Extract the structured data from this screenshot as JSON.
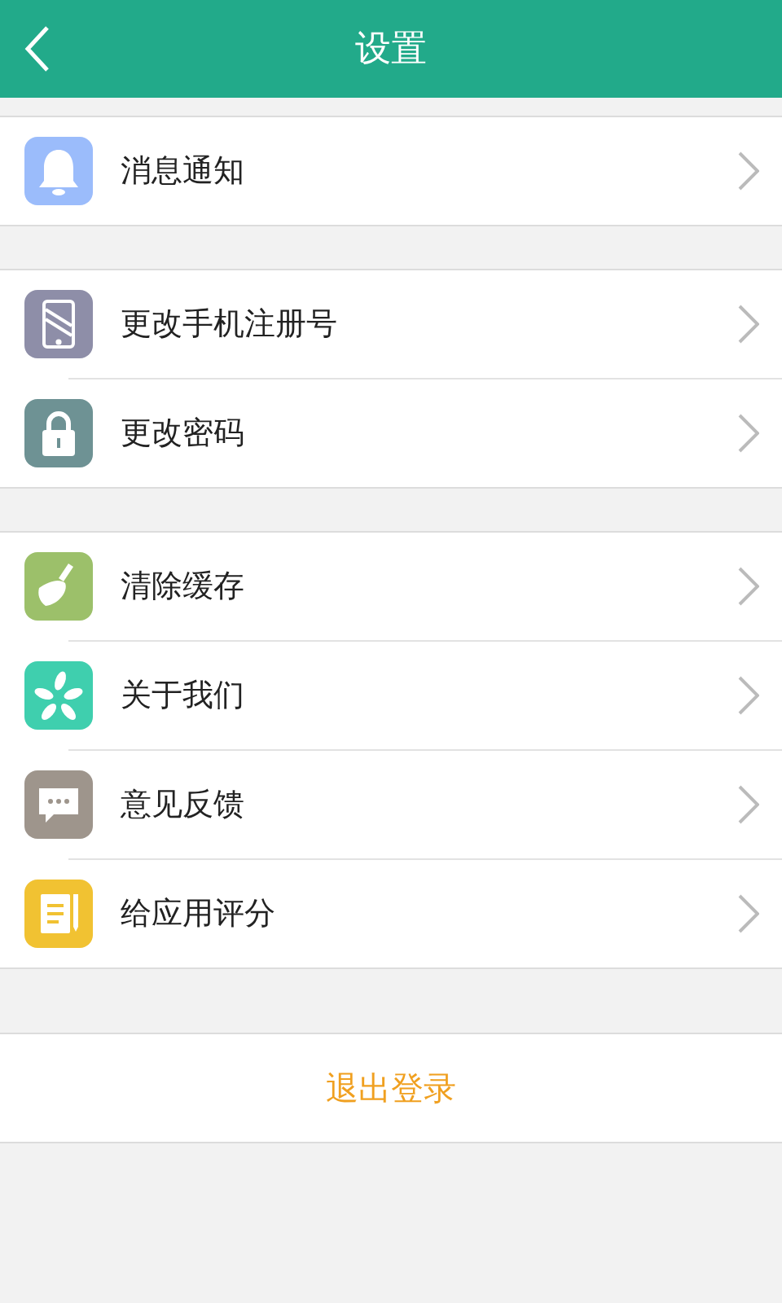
{
  "header": {
    "title": "设置"
  },
  "groups": [
    {
      "items": [
        {
          "label": "消息通知",
          "kind": "bell",
          "color": "#9bbcfb"
        }
      ]
    },
    {
      "items": [
        {
          "label": "更改手机注册号",
          "kind": "phone",
          "color": "#8e8ea8"
        },
        {
          "label": "更改密码",
          "kind": "lock",
          "color": "#6e9294"
        }
      ]
    },
    {
      "items": [
        {
          "label": "清除缓存",
          "kind": "broom",
          "color": "#9cc06a"
        },
        {
          "label": "关于我们",
          "kind": "flower",
          "color": "#3fcfae"
        },
        {
          "label": "意见反馈",
          "kind": "chat",
          "color": "#9e958c"
        },
        {
          "label": "给应用评分",
          "kind": "note",
          "color": "#f1c232"
        }
      ]
    }
  ],
  "logout": {
    "label": "退出登录"
  }
}
